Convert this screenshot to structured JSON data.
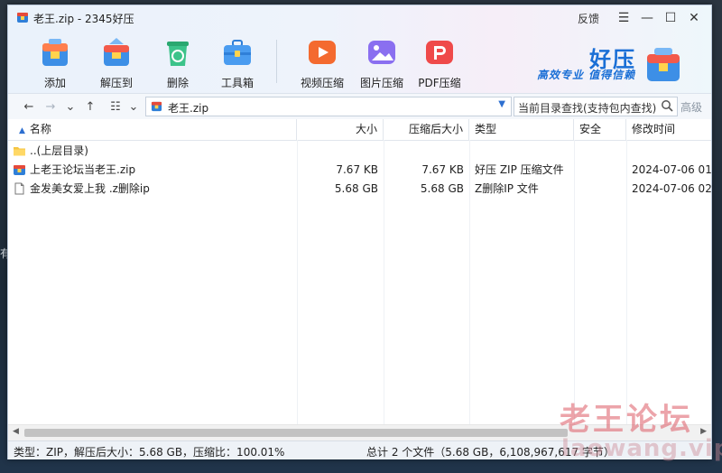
{
  "window": {
    "title": "老王.zip - 2345好压",
    "feedback_label": "反馈",
    "controls": {
      "menu": "☰",
      "minimize": "—",
      "maximize": "☐",
      "close": "✕"
    }
  },
  "toolbar": {
    "items": [
      {
        "label": "添加",
        "icon": "add-archive-icon"
      },
      {
        "label": "解压到",
        "icon": "extract-to-icon"
      },
      {
        "label": "删除",
        "icon": "recycle-delete-icon"
      },
      {
        "label": "工具箱",
        "icon": "toolbox-icon"
      },
      {
        "label": "视频压缩",
        "icon": "video-compress-icon"
      },
      {
        "label": "图片压缩",
        "icon": "image-compress-icon"
      },
      {
        "label": "PDF压缩",
        "icon": "pdf-compress-icon"
      }
    ]
  },
  "brand": {
    "name": "好压",
    "slogan": "高效专业 值得信赖"
  },
  "address": {
    "back": "←",
    "forward": "→",
    "history": "⌄",
    "up": "↑",
    "view": "☷",
    "view_dd": "⌄",
    "path": "老王.zip",
    "search_placeholder": "当前目录查找(支持包内查找)",
    "advanced_label": "高级"
  },
  "columns": {
    "name": "名称",
    "size": "大小",
    "packed": "压缩后大小",
    "type": "类型",
    "security": "安全",
    "modified": "修改时间"
  },
  "rows": [
    {
      "icon": "folder-icon",
      "name": "..(上层目录)",
      "size": "",
      "packed": "",
      "type": "",
      "security": "",
      "modified": ""
    },
    {
      "icon": "zip-archive-icon",
      "name": "上老王论坛当老王.zip",
      "size": "7.67 KB",
      "packed": "7.67 KB",
      "type": "好压 ZIP 压缩文件",
      "security": "",
      "modified": "2024-07-06 01:"
    },
    {
      "icon": "file-icon",
      "name": "金发美女爱上我 .z删除ip",
      "size": "5.68 GB",
      "packed": "5.68 GB",
      "type": "Z删除IP 文件",
      "security": "",
      "modified": "2024-07-06 02:0"
    }
  ],
  "status": {
    "left": "类型：ZIP，解压后大小：5.68 GB，压缩比：100.01%",
    "right": "总计 2 个文件（5.68 GB，6,108,967,617 字节）"
  },
  "watermark": {
    "line1": "老王论坛",
    "line2": "laowang.vip"
  },
  "edge_text": "有",
  "colors": {
    "accent": "#2d6fd0",
    "brand": "#1a6fd6",
    "watermark": "#dc5a64"
  }
}
